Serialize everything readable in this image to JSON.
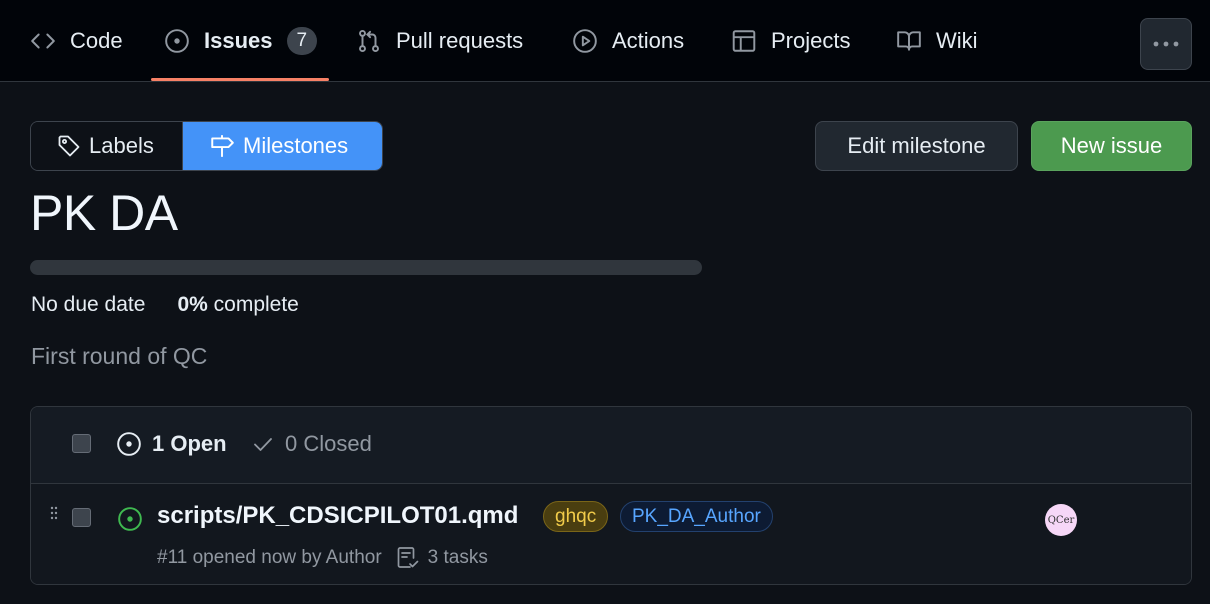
{
  "nav": {
    "tabs": [
      {
        "label": "Code",
        "icon": "code-icon"
      },
      {
        "label": "Issues",
        "icon": "issue-opened-icon",
        "count": "7"
      },
      {
        "label": "Pull requests",
        "icon": "git-pull-request-icon"
      },
      {
        "label": "Actions",
        "icon": "play-icon"
      },
      {
        "label": "Projects",
        "icon": "table-icon"
      },
      {
        "label": "Wiki",
        "icon": "book-icon"
      }
    ],
    "active_tab": "Issues",
    "more_icon": "kebab-horizontal-icon"
  },
  "toolbar": {
    "labels_label": "Labels",
    "milestones_label": "Milestones",
    "edit_label": "Edit milestone",
    "new_issue_label": "New issue"
  },
  "milestone": {
    "title": "PK DA",
    "progress_fraction": 0,
    "due": "No due date",
    "percent": "0%",
    "complete_word": "complete",
    "description": "First round of QC"
  },
  "issues": {
    "open_label": "1 Open",
    "closed_label": "0 Closed",
    "items": [
      {
        "title": "scripts/PK_CDSICPILOT01.qmd",
        "labels": [
          "ghqc",
          "PK_DA_Author"
        ],
        "meta": "#11 opened now by Author",
        "tasks": "3 tasks",
        "assignee_avatar_text": "QCer"
      }
    ]
  },
  "colors": {
    "accent_blue": "#4493f8",
    "new_issue_green": "#4c9a4f",
    "open_green": "#3fb950",
    "tab_underline": "#f78166"
  }
}
